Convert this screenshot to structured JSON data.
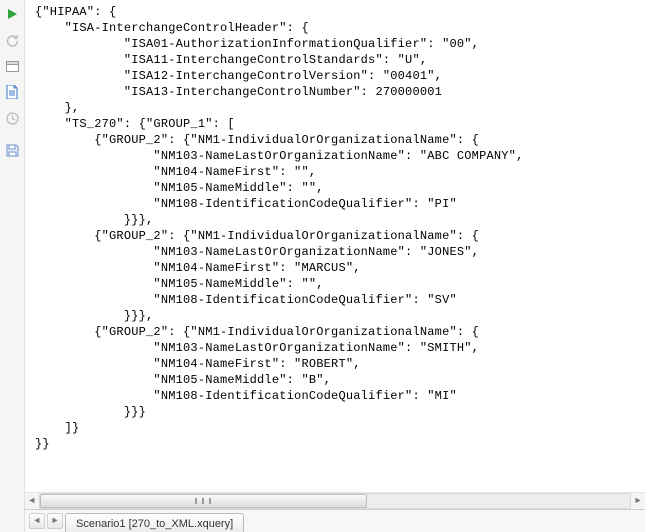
{
  "tab": {
    "label": "Scenario1 [270_to_XML.xquery]"
  },
  "code": {
    "l01": "{\"HIPAA\": {",
    "l02": "    \"ISA-InterchangeControlHeader\": {",
    "l03": "            \"ISA01-AuthorizationInformationQualifier\": \"00\",",
    "l04": "            \"ISA11-InterchangeControlStandards\": \"U\",",
    "l05": "            \"ISA12-InterchangeControlVersion\": \"00401\",",
    "l06": "            \"ISA13-InterchangeControlNumber\": 270000001",
    "l07": "    },",
    "l08": "    \"TS_270\": {\"GROUP_1\": [",
    "l09": "        {\"GROUP_2\": {\"NM1-IndividualOrOrganizationalName\": {",
    "l10": "                \"NM103-NameLastOrOrganizationName\": \"ABC COMPANY\",",
    "l11": "                \"NM104-NameFirst\": \"\",",
    "l12": "                \"NM105-NameMiddle\": \"\",",
    "l13": "                \"NM108-IdentificationCodeQualifier\": \"PI\"",
    "l14": "            }}},",
    "l15": "        {\"GROUP_2\": {\"NM1-IndividualOrOrganizationalName\": {",
    "l16": "                \"NM103-NameLastOrOrganizationName\": \"JONES\",",
    "l17": "                \"NM104-NameFirst\": \"MARCUS\",",
    "l18": "                \"NM105-NameMiddle\": \"\",",
    "l19": "                \"NM108-IdentificationCodeQualifier\": \"SV\"",
    "l20": "            }}},",
    "l21": "        {\"GROUP_2\": {\"NM1-IndividualOrOrganizationalName\": {",
    "l22": "                \"NM103-NameLastOrOrganizationName\": \"SMITH\",",
    "l23": "                \"NM104-NameFirst\": \"ROBERT\",",
    "l24": "                \"NM105-NameMiddle\": \"B\",",
    "l25": "                \"NM108-IdentificationCodeQualifier\": \"MI\"",
    "l26": "            }}}",
    "l27": "    ]}",
    "l28": "}}"
  },
  "chart_data": {
    "type": "table",
    "note": "JSON payload shown in editor",
    "HIPAA": {
      "ISA-InterchangeControlHeader": {
        "ISA01-AuthorizationInformationQualifier": "00",
        "ISA11-InterchangeControlStandards": "U",
        "ISA12-InterchangeControlVersion": "00401",
        "ISA13-InterchangeControlNumber": 270000001
      },
      "TS_270": {
        "GROUP_1": [
          {
            "GROUP_2": {
              "NM1-IndividualOrOrganizationalName": {
                "NM103-NameLastOrOrganizationName": "ABC COMPANY",
                "NM104-NameFirst": "",
                "NM105-NameMiddle": "",
                "NM108-IdentificationCodeQualifier": "PI"
              }
            }
          },
          {
            "GROUP_2": {
              "NM1-IndividualOrOrganizationalName": {
                "NM103-NameLastOrOrganizationName": "JONES",
                "NM104-NameFirst": "MARCUS",
                "NM105-NameMiddle": "",
                "NM108-IdentificationCodeQualifier": "SV"
              }
            }
          },
          {
            "GROUP_2": {
              "NM1-IndividualOrOrganizationalName": {
                "NM103-NameLastOrOrganizationName": "SMITH",
                "NM104-NameFirst": "ROBERT",
                "NM105-NameMiddle": "B",
                "NM108-IdentificationCodeQualifier": "MI"
              }
            }
          }
        ]
      }
    }
  }
}
